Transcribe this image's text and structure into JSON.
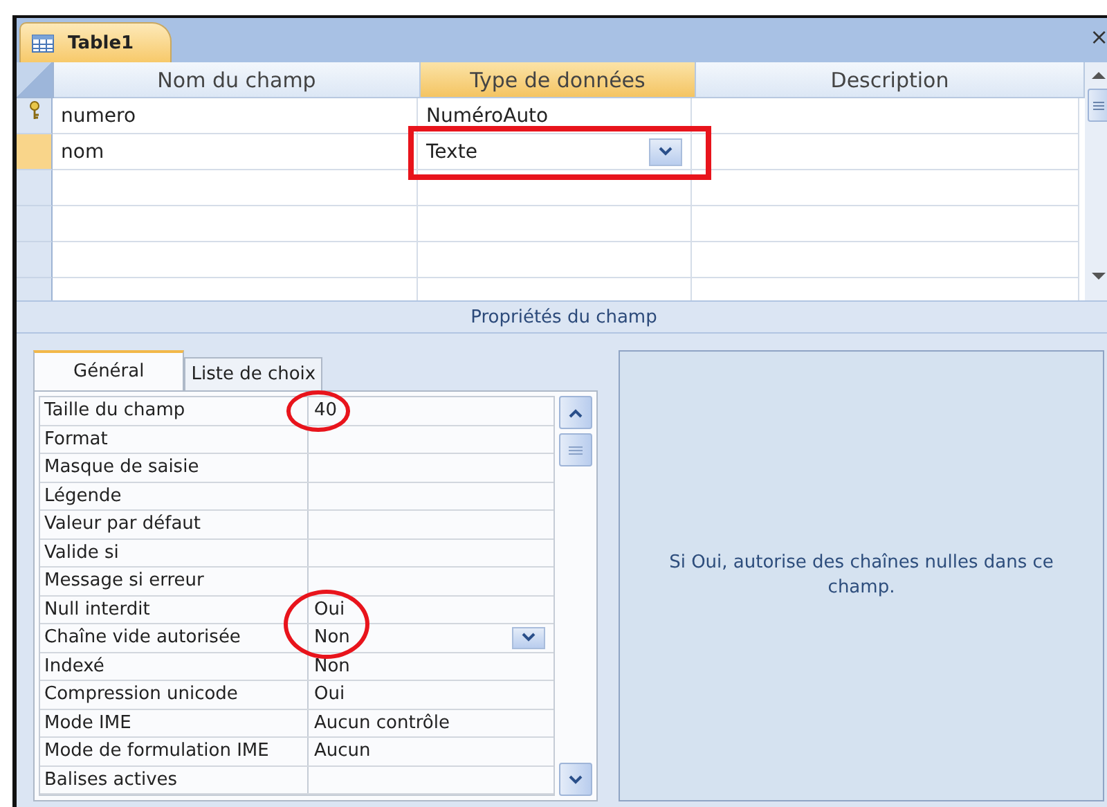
{
  "window": {
    "tab": "Table1",
    "close": "×"
  },
  "columns": [
    {
      "label": "Nom du champ",
      "selected": false
    },
    {
      "label": "Type de données",
      "selected": true
    },
    {
      "label": "Description",
      "selected": false
    }
  ],
  "rows": [
    {
      "name": "numero",
      "type": "NuméroAuto",
      "primary_key": true,
      "selected": false,
      "highlighted": false
    },
    {
      "name": "nom",
      "type": "Texte",
      "primary_key": false,
      "selected": true,
      "highlighted": true
    }
  ],
  "properties_title": "Propriétés du champ",
  "property_tabs": [
    {
      "label": "Général",
      "selected": true
    },
    {
      "label": "Liste de choix",
      "selected": false
    }
  ],
  "properties": [
    {
      "label": "Taille du champ",
      "value": "40",
      "circled": true,
      "dropdown": false
    },
    {
      "label": "Format",
      "circled": false,
      "dropdown": false
    },
    {
      "label": "Masque de saisie",
      "circled": false,
      "dropdown": false
    },
    {
      "label": "Légende",
      "circled": false,
      "dropdown": false
    },
    {
      "label": "Valeur par défaut",
      "circled": false,
      "dropdown": false
    },
    {
      "label": "Valide si",
      "circled": false,
      "dropdown": false
    },
    {
      "label": "Message si erreur",
      "circled": false,
      "dropdown": false
    },
    {
      "label": "Null interdit",
      "value": "Oui",
      "circled": true,
      "dropdown": false
    },
    {
      "label": "Chaîne vide autorisée",
      "value": "Non",
      "circled": true,
      "dropdown": true
    },
    {
      "label": "Indexé",
      "value": "Non",
      "circled": false,
      "dropdown": false
    },
    {
      "label": "Compression unicode",
      "value": "Oui",
      "circled": false,
      "dropdown": false
    },
    {
      "label": "Mode IME",
      "value": "Aucun contrôle",
      "circled": false,
      "dropdown": false
    },
    {
      "label": "Mode de formulation IME",
      "value": "Aucun",
      "circled": false,
      "dropdown": false
    },
    {
      "label": "Balises actives",
      "circled": false,
      "dropdown": false
    }
  ],
  "help_text": "Si Oui, autorise des chaînes nulles dans ce champ."
}
